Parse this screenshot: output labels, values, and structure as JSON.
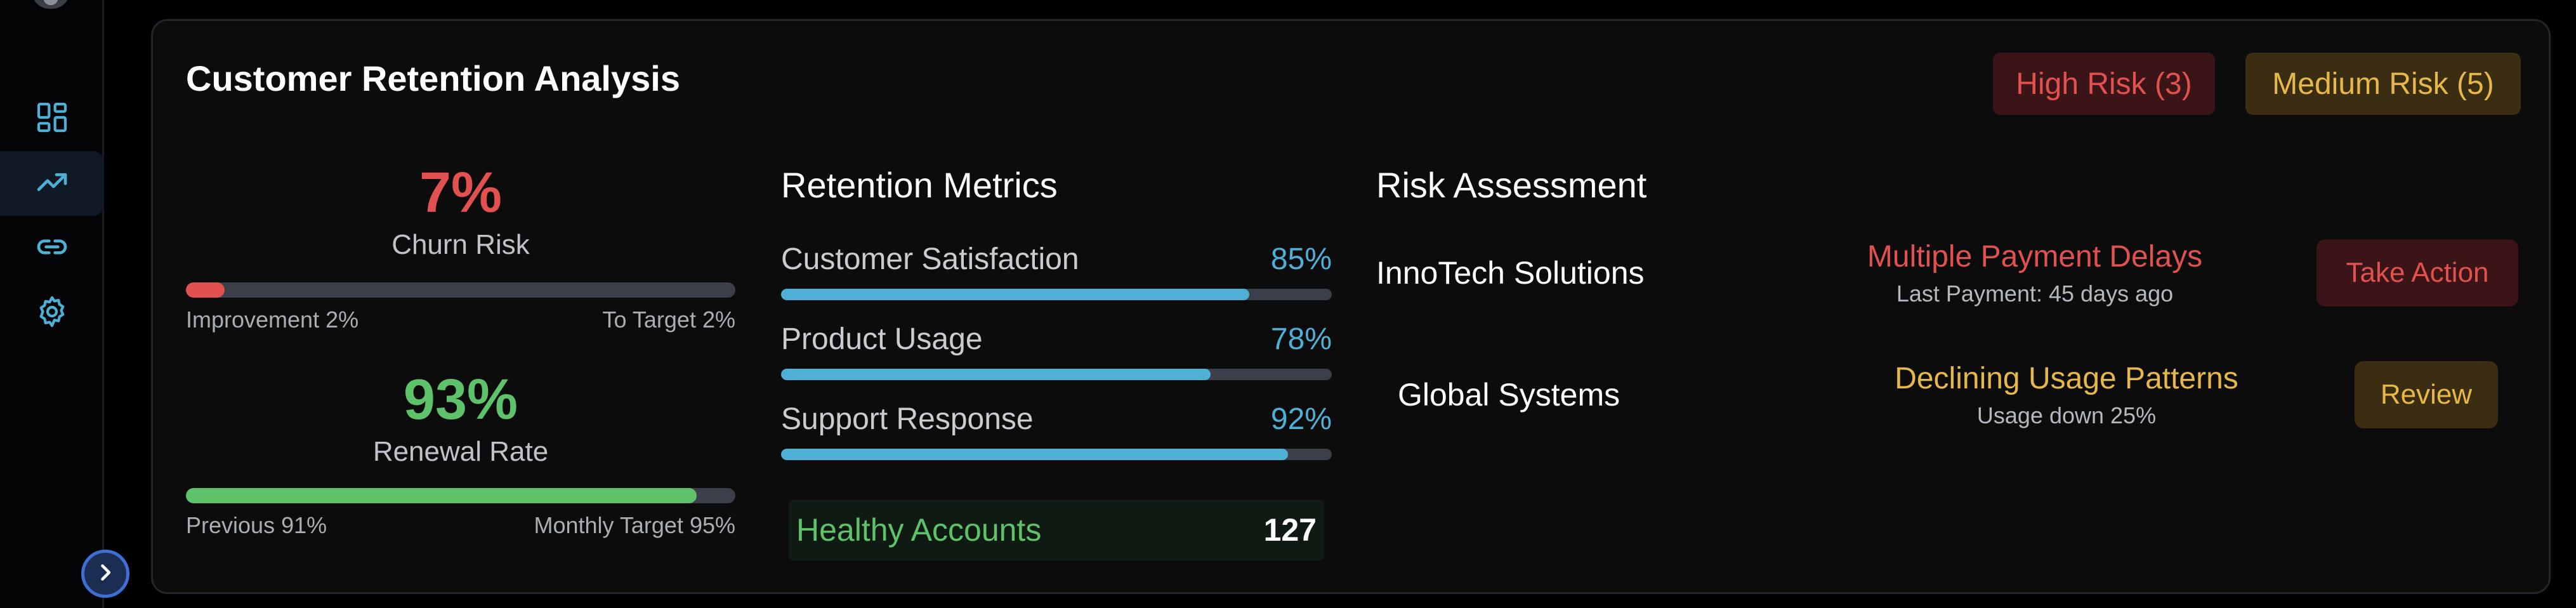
{
  "sidebar": {
    "items": [
      {
        "icon": "dashboard-icon",
        "active": false
      },
      {
        "icon": "trending-up-icon",
        "active": true
      },
      {
        "icon": "link-icon",
        "active": false
      },
      {
        "icon": "gear-icon",
        "active": false
      }
    ],
    "expand_icon": "chevron-right-icon"
  },
  "card": {
    "title": "Customer Retention Analysis",
    "badges": {
      "high_risk": "High Risk (3)",
      "medium_risk": "Medium Risk (5)"
    }
  },
  "kpis": {
    "churn": {
      "value": "7%",
      "label": "Churn Risk",
      "bar_fraction": 0.07,
      "left_caption": "Improvement 2%",
      "right_caption": "To Target 2%"
    },
    "renewal": {
      "value": "93%",
      "label": "Renewal Rate",
      "bar_fraction": 0.93,
      "left_caption": "Previous 91%",
      "right_caption": "Monthly Target 95%"
    }
  },
  "retention": {
    "title": "Retention Metrics",
    "metrics": [
      {
        "name": "Customer Satisfaction",
        "pct": "85%",
        "fraction": 0.85
      },
      {
        "name": "Product Usage",
        "pct": "78%",
        "fraction": 0.78
      },
      {
        "name": "Support Response",
        "pct": "92%",
        "fraction": 0.92
      }
    ],
    "healthy": {
      "label": "Healthy Accounts",
      "count": "127"
    }
  },
  "risk": {
    "title": "Risk Assessment",
    "rows": [
      {
        "company": "InnoTech Solutions",
        "issue": "Multiple Payment Delays",
        "detail": "Last Payment: 45 days ago",
        "action": "Take Action"
      },
      {
        "company": "Global Systems",
        "issue": "Declining Usage Patterns",
        "detail": "Usage down 25%",
        "action": "Review"
      }
    ]
  },
  "colors": {
    "danger": "#e0514f",
    "warning": "#e6b84a",
    "success": "#5ec26a",
    "info": "#4fb0d6",
    "track": "#3a3f49"
  }
}
